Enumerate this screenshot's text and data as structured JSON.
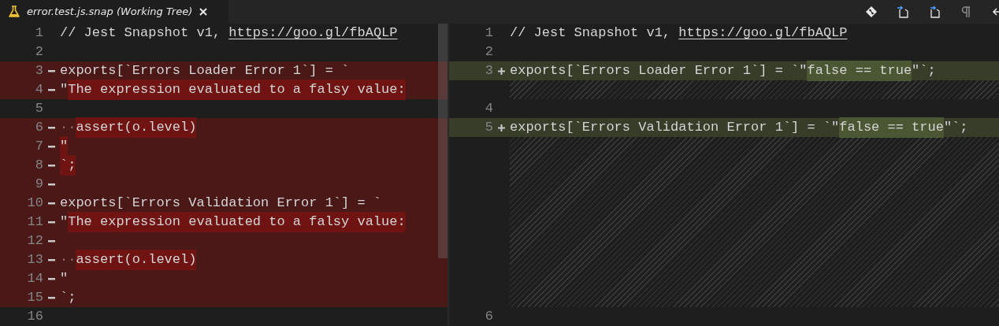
{
  "tab": {
    "title": "error.test.js.snap (Working Tree)"
  },
  "toolbar": {
    "icons": [
      {
        "kind": "git"
      },
      {
        "kind": "file-prev"
      },
      {
        "kind": "file-next"
      },
      {
        "kind": "pilcrow"
      },
      {
        "kind": "back"
      }
    ]
  },
  "left": {
    "lines": [
      {
        "number": "1",
        "kind": "context",
        "segments": [
          {
            "text": "// Jest Snapshot v1, ",
            "kind": "plain"
          },
          {
            "text": "https://goo.gl/fbAQLP",
            "kind": "link"
          }
        ]
      },
      {
        "number": "2",
        "kind": "context"
      },
      {
        "number": "3",
        "kind": "removed",
        "segments": [
          {
            "text": "exports[`Errors Loader Error 1`] = `",
            "kind": "plain"
          }
        ]
      },
      {
        "number": "4",
        "kind": "removed",
        "segments": [
          {
            "text": "\"",
            "kind": "plain"
          },
          {
            "text": "The expression evaluated to a falsy value:",
            "kind": "changed"
          }
        ]
      },
      {
        "number": "5",
        "kind": "context"
      },
      {
        "number": "6",
        "kind": "removed",
        "segments": [
          {
            "text": "··",
            "kind": "whitespace"
          },
          {
            "text": "assert(o.level)",
            "kind": "changed"
          }
        ]
      },
      {
        "number": "7",
        "kind": "removed",
        "segments": [
          {
            "text": "\"",
            "kind": "changed"
          }
        ]
      },
      {
        "number": "8",
        "kind": "removed",
        "segments": [
          {
            "text": "`;",
            "kind": "changed"
          }
        ]
      },
      {
        "number": "9",
        "kind": "removed"
      },
      {
        "number": "10",
        "kind": "removed",
        "segments": [
          {
            "text": "exports[`Errors Validation Error 1`] = `",
            "kind": "plain"
          }
        ]
      },
      {
        "number": "11",
        "kind": "removed",
        "segments": [
          {
            "text": "\"",
            "kind": "plain"
          },
          {
            "text": "The expression evaluated to a falsy value:",
            "kind": "changed"
          }
        ]
      },
      {
        "number": "12",
        "kind": "removed"
      },
      {
        "number": "13",
        "kind": "removed",
        "segments": [
          {
            "text": "··",
            "kind": "whitespace"
          },
          {
            "text": "assert(o.level)",
            "kind": "changed"
          }
        ]
      },
      {
        "number": "14",
        "kind": "removed",
        "segments": [
          {
            "text": "\"",
            "kind": "plain"
          }
        ]
      },
      {
        "number": "15",
        "kind": "removed",
        "segments": [
          {
            "text": "`;",
            "kind": "plain"
          }
        ]
      },
      {
        "number": "16",
        "kind": "context"
      }
    ]
  },
  "right": {
    "lines": [
      {
        "number": "1",
        "kind": "context",
        "segments": [
          {
            "text": "// Jest Snapshot v1, ",
            "kind": "plain"
          },
          {
            "text": "https://goo.gl/fbAQLP",
            "kind": "link"
          }
        ]
      },
      {
        "number": "2",
        "kind": "context"
      },
      {
        "number": "3",
        "kind": "added",
        "segments": [
          {
            "text": "exports[`Errors Loader Error 1`] = `\"",
            "kind": "plain"
          },
          {
            "text": "false == true",
            "kind": "changed"
          },
          {
            "text": "\"`;",
            "kind": "plain"
          }
        ]
      },
      {
        "kind": "filler"
      },
      {
        "number": "4",
        "kind": "context"
      },
      {
        "number": "5",
        "kind": "added",
        "segments": [
          {
            "text": "exports[`Errors Validation Error 1`] = `\"",
            "kind": "plain"
          },
          {
            "text": "false == true",
            "kind": "changed"
          },
          {
            "text": "\"`;",
            "kind": "plain"
          }
        ]
      },
      {
        "kind": "filler"
      },
      {
        "kind": "filler"
      },
      {
        "kind": "filler"
      },
      {
        "kind": "filler"
      },
      {
        "kind": "filler"
      },
      {
        "kind": "filler"
      },
      {
        "kind": "filler"
      },
      {
        "kind": "filler"
      },
      {
        "kind": "filler"
      },
      {
        "number": "6",
        "kind": "context"
      }
    ]
  }
}
